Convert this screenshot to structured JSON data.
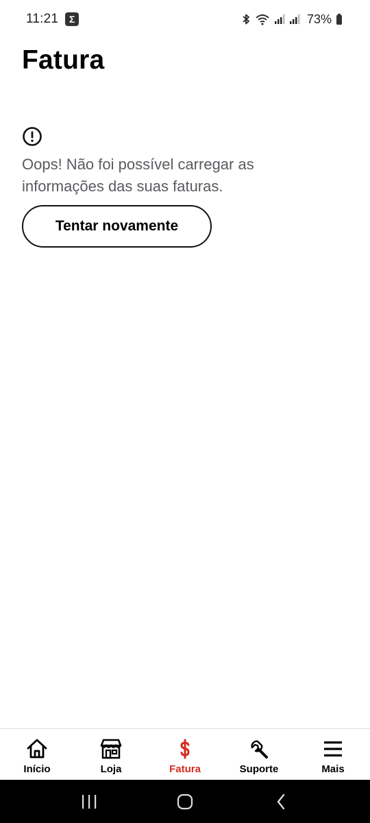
{
  "status_bar": {
    "time": "11:21",
    "notification_icon": "sigma-icon",
    "battery": "73%"
  },
  "page": {
    "title": "Fatura"
  },
  "error": {
    "icon": "alert-circle-icon",
    "message": "Oops! Não foi possível carregar as informações das suas faturas.",
    "retry_label": "Tentar novamente"
  },
  "bottom_nav": {
    "items": [
      {
        "label": "Início",
        "icon": "home-icon"
      },
      {
        "label": "Loja",
        "icon": "store-icon"
      },
      {
        "label": "Fatura",
        "icon": "dollar-icon",
        "active": true
      },
      {
        "label": "Suporte",
        "icon": "wrench-icon"
      },
      {
        "label": "Mais",
        "icon": "menu-icon"
      }
    ]
  },
  "colors": {
    "accent": "#d52b1e",
    "text": "#000000",
    "muted_text": "#5a5a60"
  }
}
